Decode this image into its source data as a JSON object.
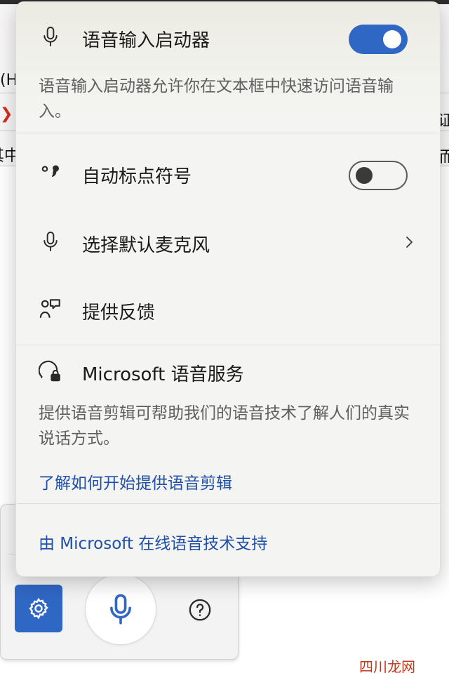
{
  "background": {
    "fragments": [
      "(H",
      "❯",
      "其中",
      "证",
      "而"
    ]
  },
  "flyout": {
    "voice_launcher": {
      "title": "语音输入启动器",
      "enabled": true,
      "description": "语音输入启动器允许你在文本框中快速访问语音输入。"
    },
    "auto_punctuation": {
      "title": "自动标点符号",
      "enabled": false
    },
    "default_mic": {
      "title": "选择默认麦克风"
    },
    "feedback": {
      "title": "提供反馈"
    },
    "speech_services": {
      "title": "Microsoft 语音服务",
      "description": "提供语音剪辑可帮助我们的语音技术了解人们的真实说话方式。",
      "link": "了解如何开始提供语音剪辑"
    },
    "footer_link": "由 Microsoft 在线语音技术支持"
  },
  "toolbar": {
    "settings_icon": "gear-icon",
    "mic_icon": "microphone-icon",
    "help_icon": "question-icon"
  },
  "colors": {
    "accent": "#2f67c4",
    "link": "#1f4fa8"
  },
  "watermark": "四川龙网"
}
